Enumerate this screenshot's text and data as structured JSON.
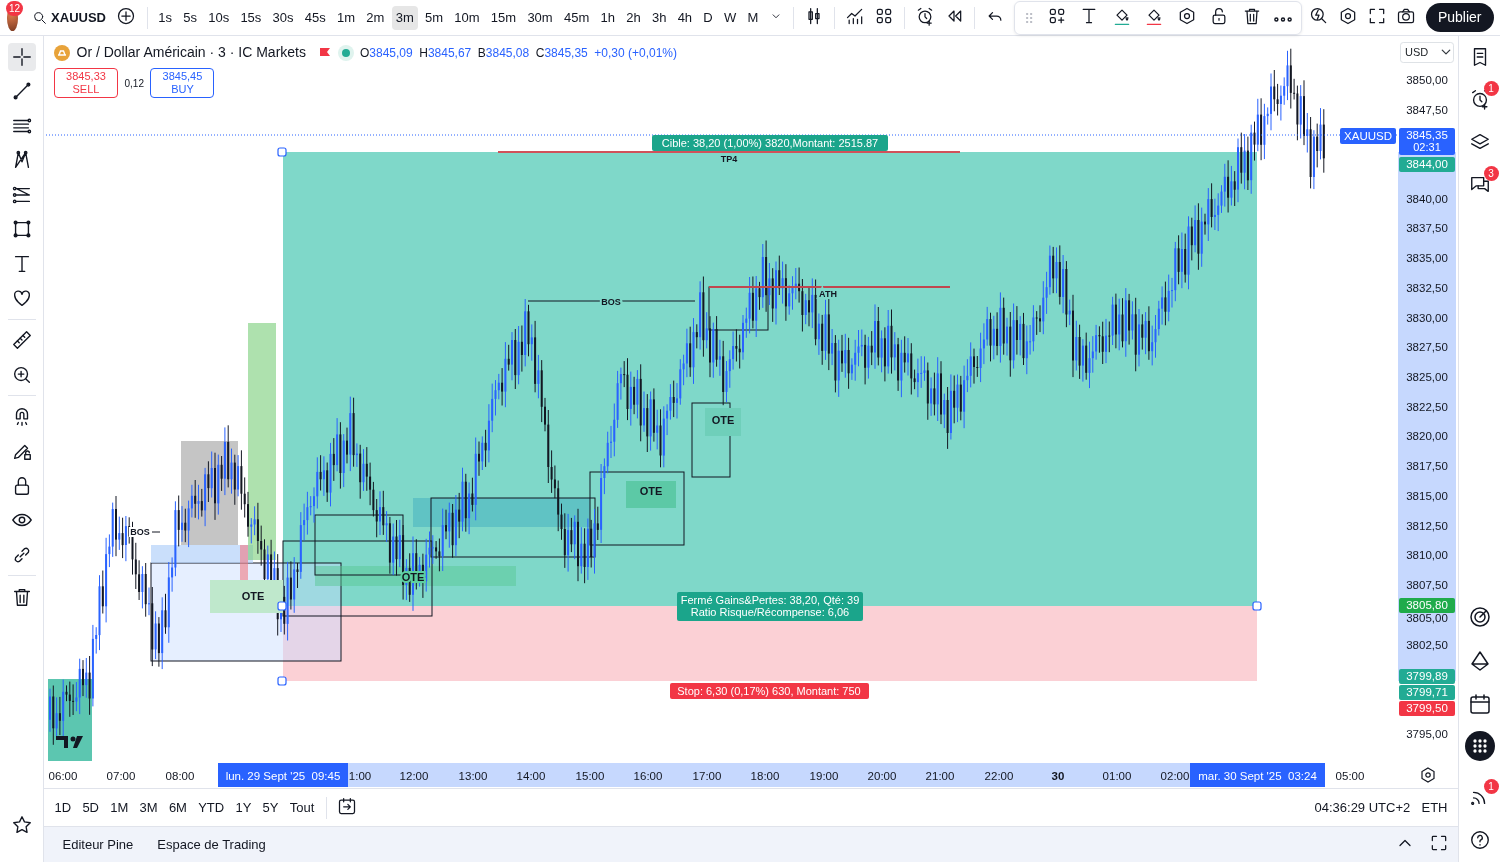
{
  "toolbar": {
    "avatar_badge": "12",
    "symbol": "XAUUSD",
    "publish": "Publier",
    "intervals": [
      {
        "label": "1s",
        "selected": false
      },
      {
        "label": "5s",
        "selected": false
      },
      {
        "label": "10s",
        "selected": false
      },
      {
        "label": "15s",
        "selected": false
      },
      {
        "label": "30s",
        "selected": false
      },
      {
        "label": "45s",
        "selected": false
      },
      {
        "label": "1m",
        "selected": false
      },
      {
        "label": "2m",
        "selected": false
      },
      {
        "label": "3m",
        "selected": true
      },
      {
        "label": "5m",
        "selected": false
      },
      {
        "label": "10m",
        "selected": false
      },
      {
        "label": "15m",
        "selected": false
      },
      {
        "label": "30m",
        "selected": false
      },
      {
        "label": "45m",
        "selected": false
      },
      {
        "label": "1h",
        "selected": false
      },
      {
        "label": "2h",
        "selected": false
      },
      {
        "label": "3h",
        "selected": false
      },
      {
        "label": "4h",
        "selected": false
      },
      {
        "label": "D",
        "selected": false
      },
      {
        "label": "W",
        "selected": false
      },
      {
        "label": "M",
        "selected": false
      }
    ]
  },
  "drawing_tools": [
    {
      "selected": true
    },
    {
      "selected": false
    },
    {
      "selected": false
    },
    {
      "selected": false
    },
    {
      "selected": false
    },
    {
      "selected": false
    },
    {
      "selected": false
    },
    {
      "selected": false
    },
    {
      "selected": false
    },
    {
      "selected": false
    },
    {
      "selected": false
    },
    {
      "selected": false
    },
    {
      "selected": false
    },
    {
      "selected": false
    },
    {
      "selected": false
    },
    {
      "selected": false
    }
  ],
  "legend": {
    "title": "Or / Dollar Américain · 3 · IC Markets",
    "market_open": true,
    "ohlc": [
      {
        "key": "O",
        "value": "3845,09"
      },
      {
        "key": "H",
        "value": "3845,67"
      },
      {
        "key": "B",
        "value": "3845,08"
      },
      {
        "key": "C",
        "value": "3845,35"
      }
    ],
    "change": "+0,30 (+0,01%)"
  },
  "trade": {
    "sell_price": "3845,33",
    "sell_label": "SELL",
    "spread": "0,12",
    "buy_price": "3845,45",
    "buy_label": "BUY"
  },
  "position": {
    "target": "Cible: 38,20 (1,00%) 3820,Montant: 2515.87",
    "result": [
      "Fermé Gains&Pertes: 38,20, Qté: 39",
      "Ratio Risque/Récompense: 6,06"
    ],
    "stop": "Stop: 6,30 (0,17%) 630, Montant: 750"
  },
  "marks": [
    {
      "kind": "line",
      "text": "TP4"
    },
    {
      "kind": "line",
      "text": "ATH"
    },
    {
      "kind": "bos",
      "text": "BOS"
    },
    {
      "kind": "bos",
      "text": "BOS"
    }
  ],
  "zones": [
    {
      "text": "OTE"
    },
    {
      "text": "OTE"
    },
    {
      "text": "OTE"
    },
    {
      "text": "OTE"
    }
  ],
  "price_axis": {
    "currency": "USD",
    "labels": [
      "3850,00",
      "3847,50",
      "3840,00",
      "3837,50",
      "3835,00",
      "3832,50",
      "3830,00",
      "3827,50",
      "3825,00",
      "3822,50",
      "3820,00",
      "3817,50",
      "3815,00",
      "3812,50",
      "3810,00",
      "3807,50",
      "3805,00",
      "3802,50",
      "3795,00"
    ],
    "symbol_tag": "XAUUSD",
    "tags": [
      {
        "text": "3845,35",
        "sub": "02:31",
        "color": "#2962ff"
      },
      {
        "text": "3844,00",
        "color": "#22ab94"
      },
      {
        "text": "3805,80",
        "color": "#1fab4b"
      },
      {
        "text": "3799,89",
        "color": "#22ab94"
      },
      {
        "text": "3799,71",
        "color": "#22ab94"
      },
      {
        "text": "3799,50",
        "color": "#f23645"
      }
    ]
  },
  "time_axis": {
    "labels": [
      {
        "text": "06:00",
        "bold": false
      },
      {
        "text": "07:00",
        "bold": false
      },
      {
        "text": "08:00",
        "bold": false
      },
      {
        "text": "1:00",
        "bold": false
      },
      {
        "text": "12:00",
        "bold": false
      },
      {
        "text": "13:00",
        "bold": false
      },
      {
        "text": "14:00",
        "bold": false
      },
      {
        "text": "15:00",
        "bold": false
      },
      {
        "text": "16:00",
        "bold": false
      },
      {
        "text": "17:00",
        "bold": false
      },
      {
        "text": "18:00",
        "bold": false
      },
      {
        "text": "19:00",
        "bold": false
      },
      {
        "text": "20:00",
        "bold": false
      },
      {
        "text": "21:00",
        "bold": false
      },
      {
        "text": "22:00",
        "bold": false
      },
      {
        "text": "30",
        "bold": true
      },
      {
        "text": "01:00",
        "bold": false
      },
      {
        "text": "02:00",
        "bold": false
      },
      {
        "text": "05:00",
        "bold": false
      }
    ],
    "cursor_tags": [
      "lun. 29 Sept '25  09:45",
      "mar. 30 Sept '25  03:24"
    ]
  },
  "range_bar": {
    "ranges": [
      "1D",
      "5D",
      "1M",
      "3M",
      "6M",
      "YTD",
      "1Y",
      "5Y",
      "Tout"
    ],
    "clock": "04:36:29 UTC+2",
    "session": "ETH"
  },
  "bottom_tabs": [
    "Editeur Pine",
    "Espace de Trading"
  ],
  "right_badges": {
    "alerts": "1",
    "chat": "3",
    "news": "1"
  }
}
